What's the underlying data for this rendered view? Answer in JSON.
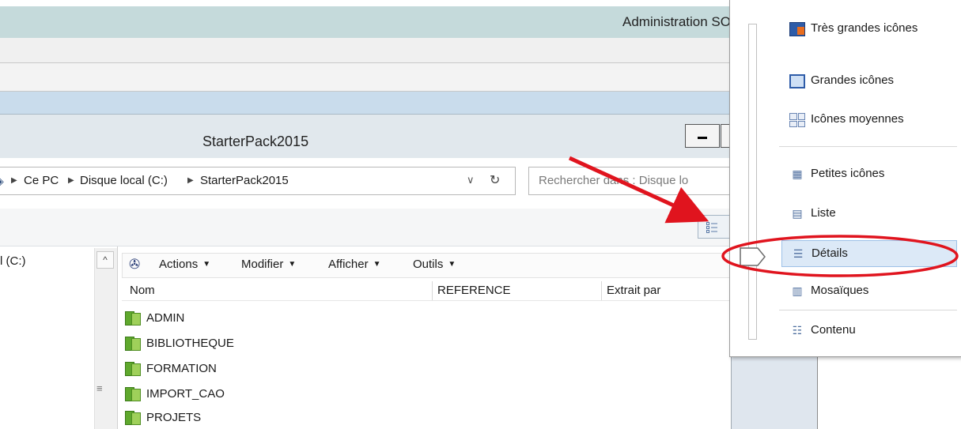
{
  "app": {
    "title": "Administration SO"
  },
  "explorer": {
    "title": "StarterPack2015",
    "breadcrumb": [
      "Ce PC",
      "Disque local (C:)",
      "StarterPack2015"
    ],
    "dropdown_glyph": "∨",
    "refresh_glyph": "↻",
    "search_placeholder": "Rechercher dans : Disque lo",
    "nav_drive": "l (C:)"
  },
  "pdm": {
    "menu": [
      "Actions",
      "Modifier",
      "Afficher",
      "Outils"
    ],
    "columns": [
      "Nom",
      "REFERENCE",
      "Extrait par"
    ],
    "folders": [
      "ADMIN",
      "BIBLIOTHEQUE",
      "FORMATION",
      "IMPORT_CAO",
      "PROJETS"
    ]
  },
  "view_menu": {
    "items": [
      {
        "label": "Très grandes icônes",
        "icon": "extra-large-icons-icon"
      },
      {
        "label": "Grandes icônes",
        "icon": "large-icons-icon"
      },
      {
        "label": "Icônes moyennes",
        "icon": "medium-icons-icon"
      },
      {
        "label": "Petites icônes",
        "icon": "small-icons-icon"
      },
      {
        "label": "Liste",
        "icon": "list-icon"
      },
      {
        "label": "Détails",
        "icon": "details-icon",
        "selected": true
      },
      {
        "label": "Mosaïques",
        "icon": "tiles-icon"
      },
      {
        "label": "Contenu",
        "icon": "content-icon"
      }
    ]
  },
  "colors": {
    "annotation_red": "#e0141e",
    "selection_fill": "#dce9f7",
    "folder_green": "#5fa82d",
    "title_bar": "#c5dadb"
  }
}
